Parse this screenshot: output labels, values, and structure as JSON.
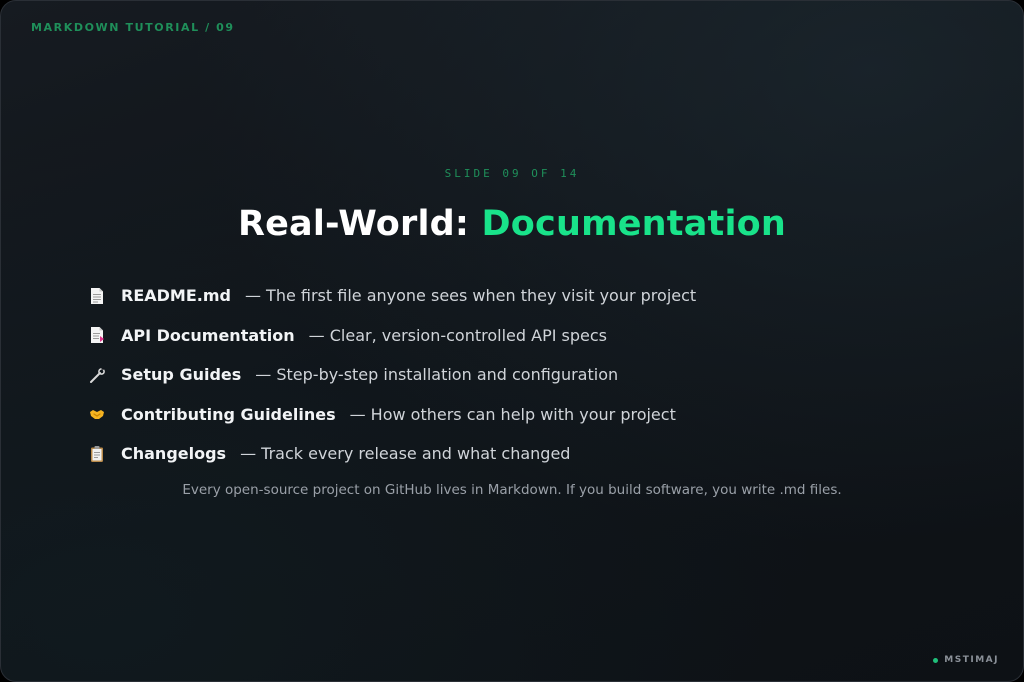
{
  "header": {
    "label": "MARKDOWN TUTORIAL / 09"
  },
  "slide": {
    "counter": "SLIDE 09 OF 14",
    "title_main": "Real-World: ",
    "title_accent": "Documentation",
    "accent_color": "#19e38a",
    "items": [
      {
        "icon": "document-icon",
        "name": "README.md",
        "desc": "— The first file anyone sees when they visit your project"
      },
      {
        "icon": "api-document-icon",
        "name": "API Documentation",
        "desc": "— Clear, version-controlled API specs"
      },
      {
        "icon": "wrench-icon",
        "name": "Setup Guides",
        "desc": "— Step-by-step installation and configuration"
      },
      {
        "icon": "handshake-icon",
        "name": "Contributing Guidelines",
        "desc": "— How others can help with your project"
      },
      {
        "icon": "clipboard-icon",
        "name": "Changelogs",
        "desc": "— Track every release and what changed"
      }
    ],
    "note": "Every open-source project on GitHub lives in Markdown. If you build software, you write .md files."
  },
  "footer": {
    "label": "MSTIMAJ",
    "dot_color": "#1fbf7a"
  }
}
